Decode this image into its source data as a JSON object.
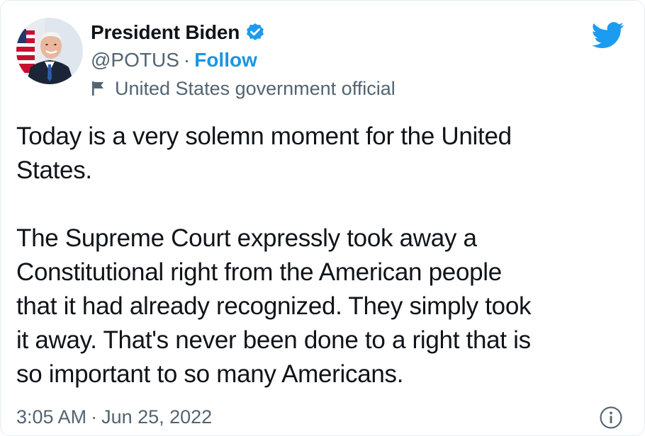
{
  "author": {
    "display_name": "President Biden",
    "handle": "@POTUS",
    "separator": "·",
    "follow_label": "Follow",
    "account_label": "United States government official",
    "verified": true
  },
  "tweet": {
    "paragraphs": [
      "Today is a very solemn moment for the United\nStates.",
      "The Supreme Court expressly took away a\nConstitutional right from the American people\nthat it had already recognized. They simply took\nit away. That's never been done to a right that is\nso important to so many Americans."
    ],
    "time": "3:05 AM",
    "separator": "·",
    "date": "Jun 25, 2022"
  },
  "icons": {
    "avatar": "profile-photo",
    "verified": "verified-badge-icon",
    "flag": "flag-icon",
    "brand": "twitter-bird-icon",
    "info": "info-icon"
  },
  "colors": {
    "brand_blue": "#1d9bf0",
    "follow_blue": "#1b95e0",
    "text_primary": "#0f1419",
    "text_secondary": "#536471"
  }
}
